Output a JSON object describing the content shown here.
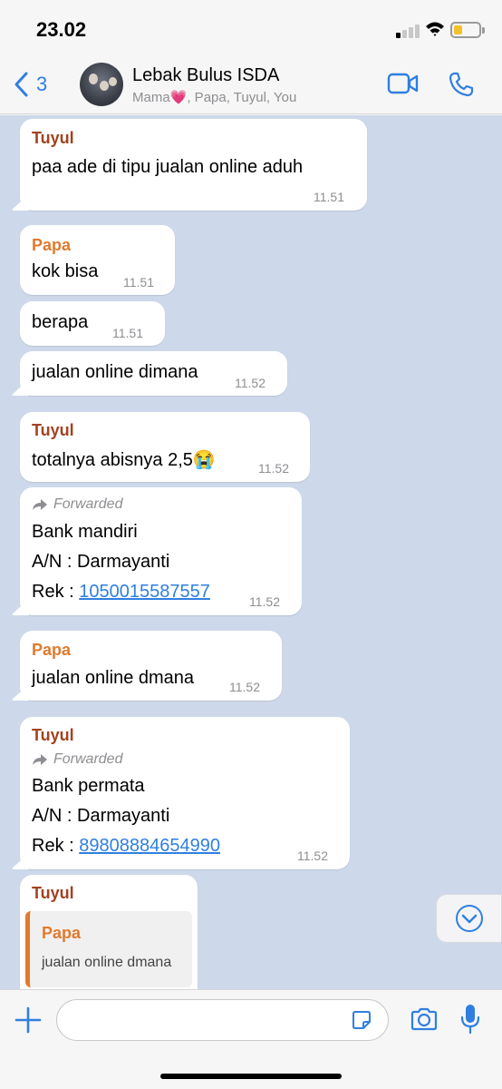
{
  "status_bar": {
    "time": "23.02",
    "battery_level_percent": 25
  },
  "header": {
    "back_count": "3",
    "title": "Lebak Bulus ISDA",
    "subtitle": "Mama💗, Papa, Tuyul, You",
    "video_icon": "video-camera-icon",
    "call_icon": "phone-icon"
  },
  "colors": {
    "accent": "#2f7fe0",
    "chat_background": "#cdd9ea",
    "sender_tuyul": "#a3421f",
    "sender_papa": "#e07a2e"
  },
  "messages": [
    {
      "sender": "Tuyul",
      "text": "paa ade di tipu jualan online aduh",
      "time": "11.51"
    },
    {
      "sender": "Papa",
      "text": "kok bisa",
      "time": "11.51"
    },
    {
      "text": "berapa",
      "time": "11.51"
    },
    {
      "text": "jualan online dimana",
      "time": "11.52"
    },
    {
      "sender": "Tuyul",
      "text": "totalnya abisnya 2,5😭",
      "time": "11.52"
    },
    {
      "forwarded_label": "Forwarded",
      "lines": [
        "Bank mandiri",
        "A/N : Darmayanti"
      ],
      "rek_label": "Rek : ",
      "rek_number": "1050015587557",
      "time": "11.52"
    },
    {
      "sender": "Papa",
      "text": "jualan online dmana",
      "time": "11.52"
    },
    {
      "sender": "Tuyul",
      "forwarded_label": "Forwarded",
      "lines": [
        "Bank permata",
        "A/N : Darmayanti"
      ],
      "rek_label": "Rek : ",
      "rek_number": "89808884654990",
      "time": "11.52"
    },
    {
      "sender": "Tuyul",
      "quote": {
        "sender": "Papa",
        "text": "jualan online dmana"
      }
    }
  ],
  "input": {
    "placeholder": ""
  }
}
